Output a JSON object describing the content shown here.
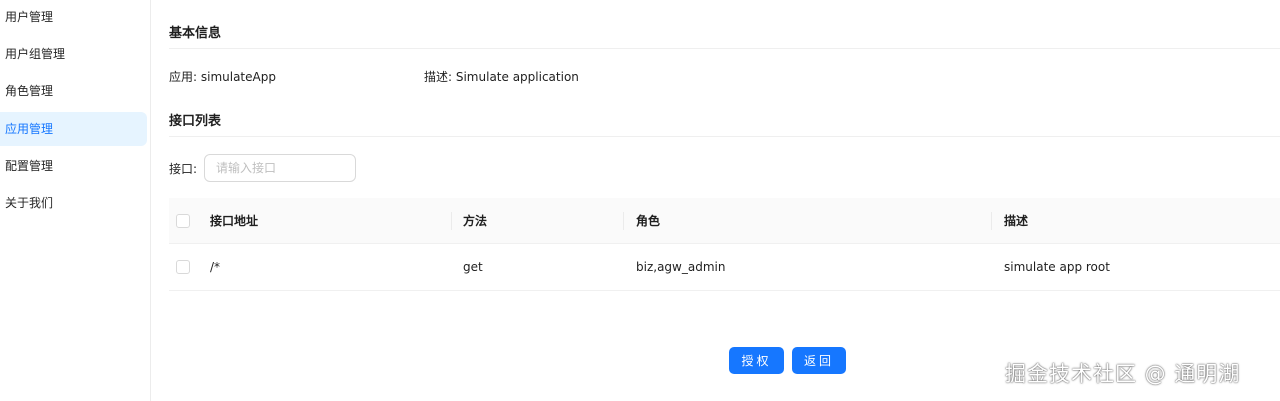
{
  "sidebar": {
    "items": [
      {
        "label": "用户管理",
        "active": false
      },
      {
        "label": "用户组管理",
        "active": false
      },
      {
        "label": "角色管理",
        "active": false
      },
      {
        "label": "应用管理",
        "active": true
      },
      {
        "label": "配置管理",
        "active": false
      },
      {
        "label": "关于我们",
        "active": false
      }
    ]
  },
  "basic_info": {
    "title": "基本信息",
    "app": "应用: simulateApp",
    "desc": "描述: Simulate application"
  },
  "api_list": {
    "title": "接口列表",
    "filter_label": "接口:",
    "filter_placeholder": "请输入接口",
    "filter_value": "",
    "columns": [
      "接口地址",
      "方法",
      "角色",
      "描述"
    ],
    "rows": [
      {
        "path": "/*",
        "method": "get",
        "roles": "biz,agw_admin",
        "desc": "simulate app root"
      }
    ]
  },
  "actions": {
    "authorize_label": "授权",
    "back_label": "返回"
  },
  "watermark": "掘金技术社区 @ 通明湖",
  "colors": {
    "primary": "#1677ff",
    "active_bg": "#e6f4ff",
    "header_bg": "#fafafa",
    "border": "#d9d9d9"
  }
}
